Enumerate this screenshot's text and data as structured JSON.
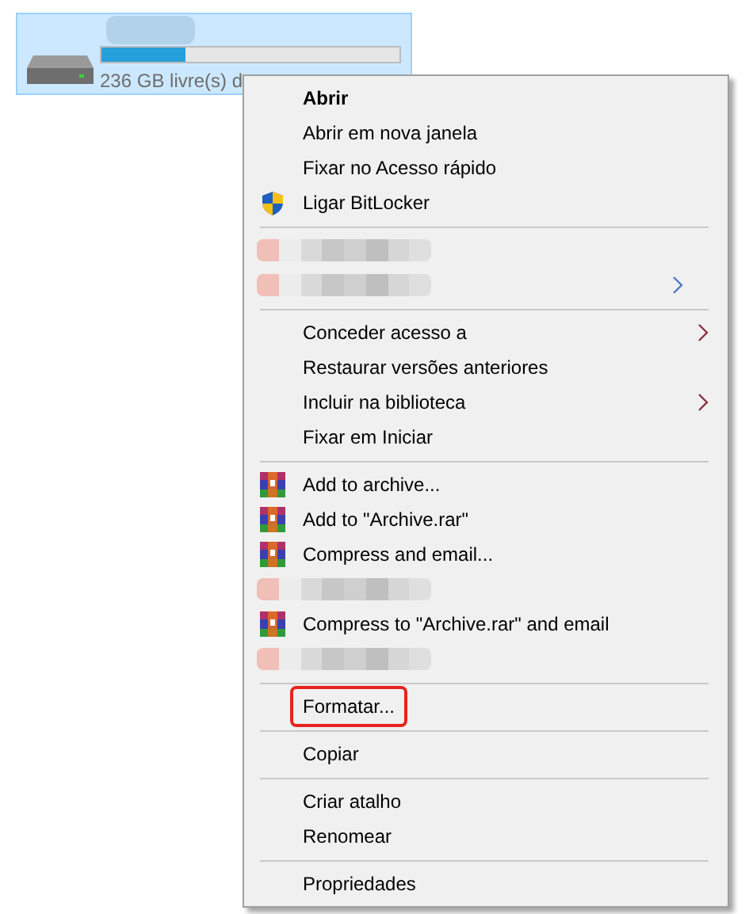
{
  "drive": {
    "selected": true,
    "capacity": {
      "level": 0.28
    },
    "free_space": "236 GB livre(s) d"
  },
  "context_menu": {
    "items": [
      {
        "kind": "plain",
        "label": "Abrir",
        "bold": true,
        "submenu": false,
        "highlighted": false
      },
      {
        "kind": "plain",
        "label": "Abrir em nova janela",
        "bold": false,
        "submenu": false,
        "highlighted": false
      },
      {
        "kind": "plain",
        "label": "Fixar no Acesso rápido",
        "bold": false,
        "submenu": false,
        "highlighted": false
      },
      {
        "kind": "shield",
        "label": "Ligar BitLocker",
        "bold": false,
        "submenu": false,
        "highlighted": false
      },
      {
        "kind": "separator"
      },
      {
        "kind": "blurred",
        "submenu": false
      },
      {
        "kind": "blurred",
        "submenu": true
      },
      {
        "kind": "separator"
      },
      {
        "kind": "plain",
        "label": "Conceder acesso a",
        "bold": false,
        "submenu": true,
        "highlighted": false
      },
      {
        "kind": "plain",
        "label": "Restaurar versões anteriores",
        "bold": false,
        "submenu": false,
        "highlighted": false
      },
      {
        "kind": "plain",
        "label": "Incluir na biblioteca",
        "bold": false,
        "submenu": true,
        "highlighted": false
      },
      {
        "kind": "plain",
        "label": "Fixar em Iniciar",
        "bold": false,
        "submenu": false,
        "highlighted": false
      },
      {
        "kind": "separator"
      },
      {
        "kind": "archive",
        "label": "Add to archive...",
        "bold": false,
        "submenu": false,
        "highlighted": false
      },
      {
        "kind": "archive",
        "label": "Add to \"Archive.rar\"",
        "bold": false,
        "submenu": false,
        "highlighted": false
      },
      {
        "kind": "archive",
        "label": "Compress and email...",
        "bold": false,
        "submenu": false,
        "highlighted": false
      },
      {
        "kind": "blurred",
        "submenu": false
      },
      {
        "kind": "archive",
        "label": "Compress to \"Archive.rar\" and email",
        "bold": false,
        "submenu": false,
        "highlighted": false
      },
      {
        "kind": "blurred",
        "submenu": false
      },
      {
        "kind": "separator"
      },
      {
        "kind": "plain",
        "label": "Formatar...",
        "bold": false,
        "submenu": false,
        "highlighted": true
      },
      {
        "kind": "separator"
      },
      {
        "kind": "plain",
        "label": "Copiar",
        "bold": false,
        "submenu": false,
        "highlighted": false
      },
      {
        "kind": "separator"
      },
      {
        "kind": "plain",
        "label": "Criar atalho",
        "bold": false,
        "submenu": false,
        "highlighted": false
      },
      {
        "kind": "plain",
        "label": "Renomear",
        "bold": false,
        "submenu": false,
        "highlighted": false
      },
      {
        "kind": "separator"
      },
      {
        "kind": "plain",
        "label": "Propriedades",
        "bold": false,
        "submenu": false,
        "highlighted": false
      }
    ]
  }
}
